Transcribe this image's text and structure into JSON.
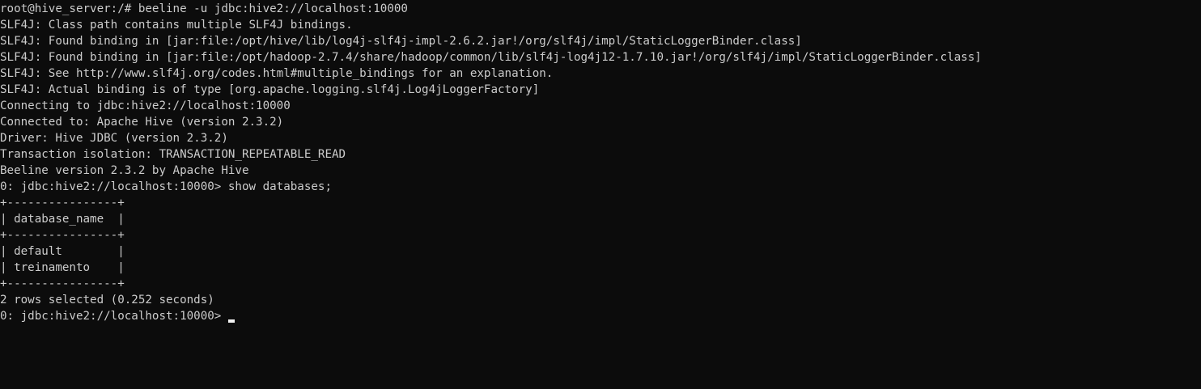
{
  "terminal": {
    "lines": [
      "root@hive_server:/# beeline -u jdbc:hive2://localhost:10000",
      "SLF4J: Class path contains multiple SLF4J bindings.",
      "SLF4J: Found binding in [jar:file:/opt/hive/lib/log4j-slf4j-impl-2.6.2.jar!/org/slf4j/impl/StaticLoggerBinder.class]",
      "SLF4J: Found binding in [jar:file:/opt/hadoop-2.7.4/share/hadoop/common/lib/slf4j-log4j12-1.7.10.jar!/org/slf4j/impl/StaticLoggerBinder.class]",
      "SLF4J: See http://www.slf4j.org/codes.html#multiple_bindings for an explanation.",
      "SLF4J: Actual binding is of type [org.apache.logging.slf4j.Log4jLoggerFactory]",
      "Connecting to jdbc:hive2://localhost:10000",
      "Connected to: Apache Hive (version 2.3.2)",
      "Driver: Hive JDBC (version 2.3.2)",
      "Transaction isolation: TRANSACTION_REPEATABLE_READ",
      "Beeline version 2.3.2 by Apache Hive",
      "0: jdbc:hive2://localhost:10000> show databases;",
      "+----------------+",
      "| database_name  |",
      "+----------------+",
      "| default        |",
      "| treinamento    |",
      "+----------------+",
      "2 rows selected (0.252 seconds)"
    ],
    "prompt": "0: jdbc:hive2://localhost:10000> ",
    "background_color": "#0c0c0c",
    "text_color": "#cccccc",
    "cursor_color": "#f2f2f2"
  }
}
